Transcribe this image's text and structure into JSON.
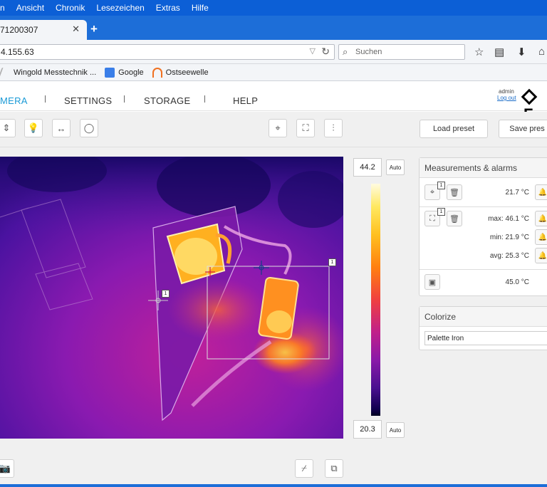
{
  "browser": {
    "menu": [
      "n",
      "Ansicht",
      "Chronik",
      "Lesezeichen",
      "Extras",
      "Hilfe"
    ],
    "tab_title": "71200307",
    "url": "4.155.63",
    "search_placeholder": "Suchen",
    "bookmarks": [
      {
        "label": "Wingold Messtechnik ...",
        "color": "#b0b0b0"
      },
      {
        "label": "Google",
        "color": "#3a7ee8"
      },
      {
        "label": "Ostseewelle",
        "color": "#f07020"
      }
    ]
  },
  "app": {
    "nav": [
      "MERA",
      "SETTINGS",
      "STORAGE",
      "HELP"
    ],
    "user": "admin",
    "logout": "Log out",
    "logo": "F",
    "toolbar": {
      "load_preset": "Load preset",
      "save_preset": "Save pres"
    },
    "scale": {
      "max": "44.2",
      "min": "20.3",
      "auto": "Auto"
    },
    "overlay_badges": [
      "1",
      "1"
    ],
    "measurements": {
      "title": "Measurements & alarms",
      "spot_badge": "1",
      "spot_value": "21.7 °C",
      "area_badge": "1",
      "area_max": "max: 46.1 °C",
      "area_min": "min: 21.9 °C",
      "area_avg": "avg: 25.3 °C",
      "internal_value": "45.0 °C"
    },
    "colorize": {
      "title": "Colorize",
      "palette": "Palette Iron"
    }
  }
}
